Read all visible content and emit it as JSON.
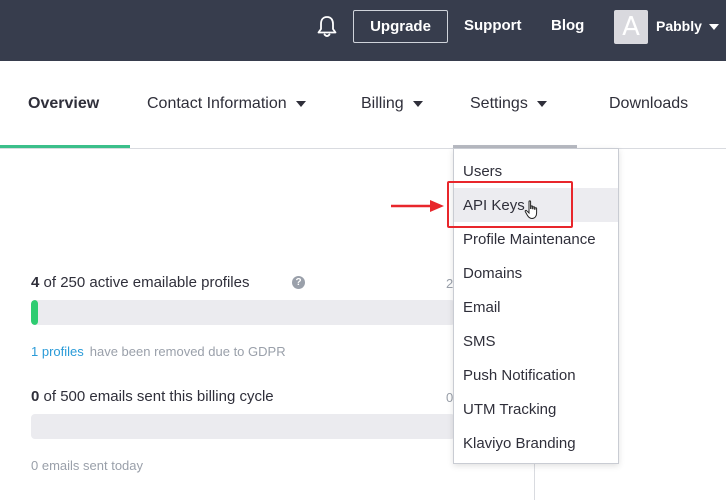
{
  "header": {
    "upgrade_label": "Upgrade",
    "support_label": "Support",
    "blog_label": "Blog",
    "avatar_letter": "A",
    "user_name": "Pabbly",
    "icons": {
      "notifications": "bell-icon",
      "user_menu": "chevron-down-icon"
    }
  },
  "nav": {
    "overview": "Overview",
    "contact": "Contact Information",
    "billing": "Billing",
    "settings": "Settings",
    "downloads": "Downloads"
  },
  "settings_menu": {
    "items": [
      "Users",
      "API Keys",
      "Profile Maintenance",
      "Domains",
      "Email",
      "SMS",
      "Push Notification",
      "UTM Tracking",
      "Klaviyo Branding"
    ],
    "hovered": "API Keys"
  },
  "stats": {
    "profiles_count": "4",
    "profiles_text": " of 250 active emailable profiles",
    "profiles_total_partial": "2",
    "profiles_progress_pct": 1.6,
    "gdpr_link": "1 profiles",
    "gdpr_text": "have been removed due to GDPR",
    "emails_count": "0",
    "emails_text": " of 500 emails sent this billing cycle",
    "emails_total_partial": "0",
    "emails_progress_pct": 0,
    "emails_today": "0 emails sent today"
  },
  "colors": {
    "topbar": "#373d4d",
    "accent_green": "#3bbf8a",
    "progress_green": "#2ecc71",
    "link_blue": "#2a9bd8",
    "annotation_red": "#e8262b"
  }
}
